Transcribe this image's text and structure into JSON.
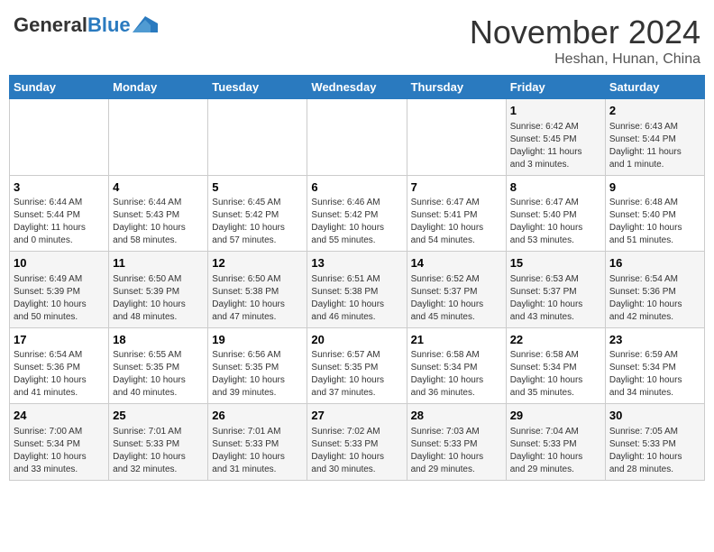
{
  "header": {
    "logo_general": "General",
    "logo_blue": "Blue",
    "month_title": "November 2024",
    "location": "Heshan, Hunan, China"
  },
  "weekdays": [
    "Sunday",
    "Monday",
    "Tuesday",
    "Wednesday",
    "Thursday",
    "Friday",
    "Saturday"
  ],
  "weeks": [
    [
      {
        "day": "",
        "info": ""
      },
      {
        "day": "",
        "info": ""
      },
      {
        "day": "",
        "info": ""
      },
      {
        "day": "",
        "info": ""
      },
      {
        "day": "",
        "info": ""
      },
      {
        "day": "1",
        "info": "Sunrise: 6:42 AM\nSunset: 5:45 PM\nDaylight: 11 hours\nand 3 minutes."
      },
      {
        "day": "2",
        "info": "Sunrise: 6:43 AM\nSunset: 5:44 PM\nDaylight: 11 hours\nand 1 minute."
      }
    ],
    [
      {
        "day": "3",
        "info": "Sunrise: 6:44 AM\nSunset: 5:44 PM\nDaylight: 11 hours\nand 0 minutes."
      },
      {
        "day": "4",
        "info": "Sunrise: 6:44 AM\nSunset: 5:43 PM\nDaylight: 10 hours\nand 58 minutes."
      },
      {
        "day": "5",
        "info": "Sunrise: 6:45 AM\nSunset: 5:42 PM\nDaylight: 10 hours\nand 57 minutes."
      },
      {
        "day": "6",
        "info": "Sunrise: 6:46 AM\nSunset: 5:42 PM\nDaylight: 10 hours\nand 55 minutes."
      },
      {
        "day": "7",
        "info": "Sunrise: 6:47 AM\nSunset: 5:41 PM\nDaylight: 10 hours\nand 54 minutes."
      },
      {
        "day": "8",
        "info": "Sunrise: 6:47 AM\nSunset: 5:40 PM\nDaylight: 10 hours\nand 53 minutes."
      },
      {
        "day": "9",
        "info": "Sunrise: 6:48 AM\nSunset: 5:40 PM\nDaylight: 10 hours\nand 51 minutes."
      }
    ],
    [
      {
        "day": "10",
        "info": "Sunrise: 6:49 AM\nSunset: 5:39 PM\nDaylight: 10 hours\nand 50 minutes."
      },
      {
        "day": "11",
        "info": "Sunrise: 6:50 AM\nSunset: 5:39 PM\nDaylight: 10 hours\nand 48 minutes."
      },
      {
        "day": "12",
        "info": "Sunrise: 6:50 AM\nSunset: 5:38 PM\nDaylight: 10 hours\nand 47 minutes."
      },
      {
        "day": "13",
        "info": "Sunrise: 6:51 AM\nSunset: 5:38 PM\nDaylight: 10 hours\nand 46 minutes."
      },
      {
        "day": "14",
        "info": "Sunrise: 6:52 AM\nSunset: 5:37 PM\nDaylight: 10 hours\nand 45 minutes."
      },
      {
        "day": "15",
        "info": "Sunrise: 6:53 AM\nSunset: 5:37 PM\nDaylight: 10 hours\nand 43 minutes."
      },
      {
        "day": "16",
        "info": "Sunrise: 6:54 AM\nSunset: 5:36 PM\nDaylight: 10 hours\nand 42 minutes."
      }
    ],
    [
      {
        "day": "17",
        "info": "Sunrise: 6:54 AM\nSunset: 5:36 PM\nDaylight: 10 hours\nand 41 minutes."
      },
      {
        "day": "18",
        "info": "Sunrise: 6:55 AM\nSunset: 5:35 PM\nDaylight: 10 hours\nand 40 minutes."
      },
      {
        "day": "19",
        "info": "Sunrise: 6:56 AM\nSunset: 5:35 PM\nDaylight: 10 hours\nand 39 minutes."
      },
      {
        "day": "20",
        "info": "Sunrise: 6:57 AM\nSunset: 5:35 PM\nDaylight: 10 hours\nand 37 minutes."
      },
      {
        "day": "21",
        "info": "Sunrise: 6:58 AM\nSunset: 5:34 PM\nDaylight: 10 hours\nand 36 minutes."
      },
      {
        "day": "22",
        "info": "Sunrise: 6:58 AM\nSunset: 5:34 PM\nDaylight: 10 hours\nand 35 minutes."
      },
      {
        "day": "23",
        "info": "Sunrise: 6:59 AM\nSunset: 5:34 PM\nDaylight: 10 hours\nand 34 minutes."
      }
    ],
    [
      {
        "day": "24",
        "info": "Sunrise: 7:00 AM\nSunset: 5:34 PM\nDaylight: 10 hours\nand 33 minutes."
      },
      {
        "day": "25",
        "info": "Sunrise: 7:01 AM\nSunset: 5:33 PM\nDaylight: 10 hours\nand 32 minutes."
      },
      {
        "day": "26",
        "info": "Sunrise: 7:01 AM\nSunset: 5:33 PM\nDaylight: 10 hours\nand 31 minutes."
      },
      {
        "day": "27",
        "info": "Sunrise: 7:02 AM\nSunset: 5:33 PM\nDaylight: 10 hours\nand 30 minutes."
      },
      {
        "day": "28",
        "info": "Sunrise: 7:03 AM\nSunset: 5:33 PM\nDaylight: 10 hours\nand 29 minutes."
      },
      {
        "day": "29",
        "info": "Sunrise: 7:04 AM\nSunset: 5:33 PM\nDaylight: 10 hours\nand 29 minutes."
      },
      {
        "day": "30",
        "info": "Sunrise: 7:05 AM\nSunset: 5:33 PM\nDaylight: 10 hours\nand 28 minutes."
      }
    ]
  ]
}
